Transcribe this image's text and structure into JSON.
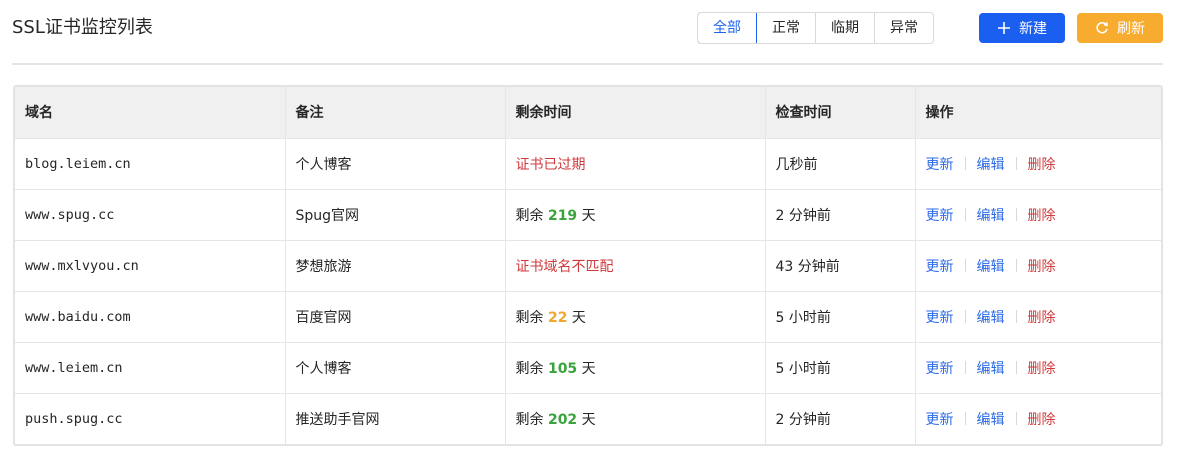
{
  "header": {
    "title": "SSL证书监控列表",
    "filters": [
      "全部",
      "正常",
      "临期",
      "异常"
    ],
    "active_filter": "全部",
    "new_label": "新建",
    "refresh_label": "刷新"
  },
  "colors": {
    "primary": "#1a5ff0",
    "warning": "#f7ac2f",
    "danger": "#d0393b",
    "success": "#3aa33c",
    "orange": "#f0a72c"
  },
  "table": {
    "columns": [
      "域名",
      "备注",
      "剩余时间",
      "检查时间",
      "操作"
    ],
    "actions": {
      "update": "更新",
      "edit": "编辑",
      "delete": "删除"
    },
    "rows": [
      {
        "domain": "blog.leiem.cn",
        "note": "个人博客",
        "remain": {
          "type": "error",
          "text": "证书已过期"
        },
        "checked": "几秒前"
      },
      {
        "domain": "www.spug.cc",
        "note": "Spug官网",
        "remain": {
          "type": "days",
          "prefix": "剩余",
          "days": "219",
          "suffix": "天",
          "level": "green"
        },
        "checked": "2 分钟前"
      },
      {
        "domain": "www.mxlvyou.cn",
        "note": "梦想旅游",
        "remain": {
          "type": "error",
          "text": "证书域名不匹配"
        },
        "checked": "43 分钟前"
      },
      {
        "domain": "www.baidu.com",
        "note": "百度官网",
        "remain": {
          "type": "days",
          "prefix": "剩余",
          "days": "22",
          "suffix": "天",
          "level": "orange"
        },
        "checked": "5 小时前"
      },
      {
        "domain": "www.leiem.cn",
        "note": "个人博客",
        "remain": {
          "type": "days",
          "prefix": "剩余",
          "days": "105",
          "suffix": "天",
          "level": "green"
        },
        "checked": "5 小时前"
      },
      {
        "domain": "push.spug.cc",
        "note": "推送助手官网",
        "remain": {
          "type": "days",
          "prefix": "剩余",
          "days": "202",
          "suffix": "天",
          "level": "green"
        },
        "checked": "2 分钟前"
      }
    ]
  }
}
